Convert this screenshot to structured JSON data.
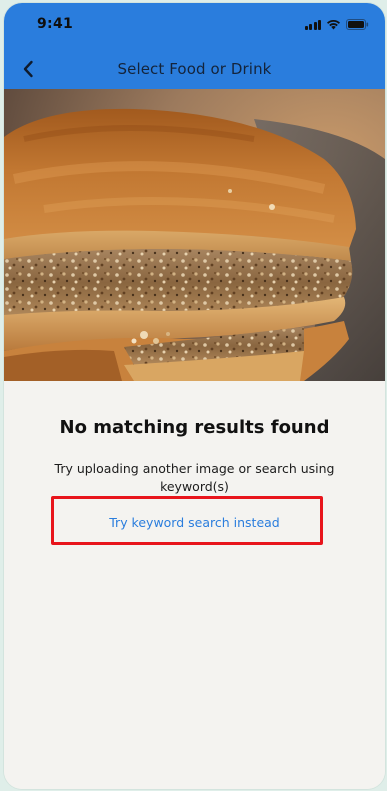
{
  "status_bar": {
    "time": "9:41",
    "icons": [
      "signal-icon",
      "wifi-icon",
      "battery-icon"
    ]
  },
  "nav": {
    "title": "Select Food or Drink",
    "back_icon": "chevron-left-icon"
  },
  "result": {
    "heading": "No matching results found",
    "message": "Try uploading another image or search using keyword(s)",
    "link_label": "Try keyword search instead"
  },
  "colors": {
    "header_blue": "#2a7ddd",
    "link_blue": "#2a7ddd",
    "highlight_red": "#e8141b",
    "background": "#f4f3f0"
  }
}
